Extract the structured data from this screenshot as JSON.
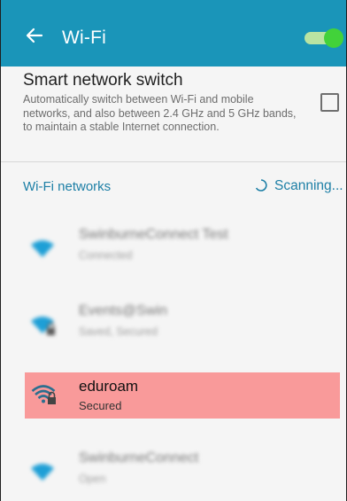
{
  "app_bar": {
    "title": "Wi-Fi",
    "wifi_enabled": true,
    "colors": {
      "background": "#1a95b9",
      "toggle_knob": "#42d23a",
      "toggle_track": "#b9e4a2"
    }
  },
  "smart_switch": {
    "title": "Smart network switch",
    "description": "Automatically switch between Wi-Fi and mobile networks, and also between 2.4 GHz and 5 GHz bands, to maintain a stable Internet connection.",
    "checked": false
  },
  "networks_section": {
    "label": "Wi-Fi networks",
    "status": "Scanning...",
    "accent": "#1d7fa6"
  },
  "networks": [
    {
      "name": "SwinburneConnect Test",
      "status": "Connected",
      "secured": false,
      "blurred": true
    },
    {
      "name": "Events@Swin",
      "status": "Saved, Secured",
      "secured": true,
      "blurred": true
    },
    {
      "name": "eduroam",
      "status": "Secured",
      "secured": true,
      "blurred": false,
      "highlighted": true
    },
    {
      "name": "SwinburneConnect",
      "status": "Open",
      "secured": false,
      "blurred": true
    }
  ]
}
